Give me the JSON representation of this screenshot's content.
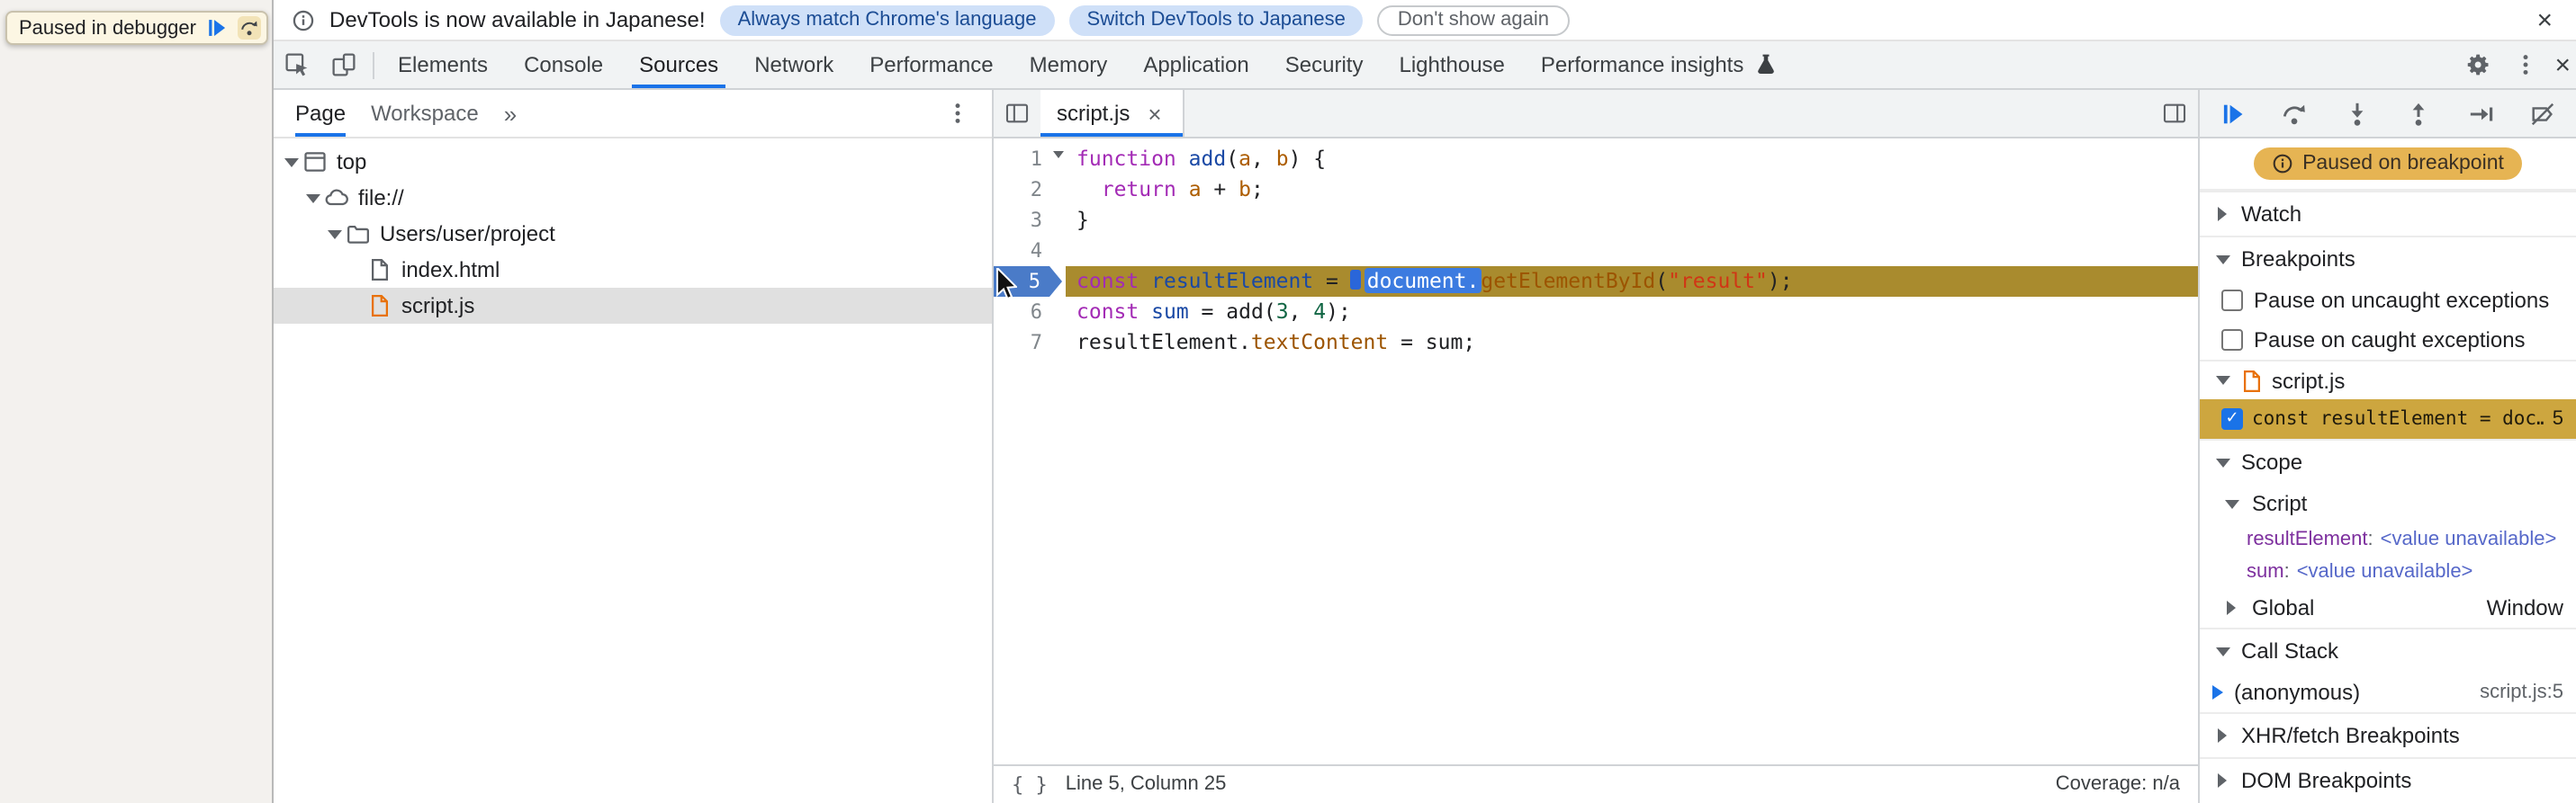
{
  "page_overlay": {
    "paused_label": "Paused in debugger"
  },
  "infobar": {
    "message": "DevTools is now available in Japanese!",
    "action_primary": "Always match Chrome's language",
    "action_secondary": "Switch DevTools to Japanese",
    "action_dismiss": "Don't show again",
    "close_glyph": "×"
  },
  "toolbar": {
    "tabs": [
      {
        "label": "Elements"
      },
      {
        "label": "Console"
      },
      {
        "label": "Sources"
      },
      {
        "label": "Network"
      },
      {
        "label": "Performance"
      },
      {
        "label": "Memory"
      },
      {
        "label": "Application"
      },
      {
        "label": "Security"
      },
      {
        "label": "Lighthouse"
      },
      {
        "label": "Performance insights",
        "icon": "flask-icon"
      }
    ],
    "active_tab": "Sources",
    "close_glyph": "×"
  },
  "navigator": {
    "tabs": [
      "Page",
      "Workspace"
    ],
    "active_tab": "Page",
    "overflow_glyph": "»",
    "tree": [
      {
        "depth": 0,
        "icon": "frame-icon",
        "label": "top",
        "expanded": true
      },
      {
        "depth": 1,
        "icon": "cloud-icon",
        "label": "file://",
        "expanded": true
      },
      {
        "depth": 2,
        "icon": "folder-icon",
        "label": "Users/user/project",
        "expanded": true
      },
      {
        "depth": 3,
        "icon": "file-icon",
        "label": "index.html"
      },
      {
        "depth": 3,
        "icon": "file-js-icon",
        "label": "script.js",
        "selected": true
      }
    ]
  },
  "editor": {
    "tab": {
      "label": "script.js",
      "close_glyph": "×"
    },
    "lines": [
      {
        "num": "1",
        "fold": true,
        "tokens": [
          [
            "k",
            "function"
          ],
          [
            "t",
            " "
          ],
          [
            "d",
            "add"
          ],
          [
            "t",
            "("
          ],
          [
            "p",
            "a"
          ],
          [
            "t",
            ", "
          ],
          [
            "p",
            "b"
          ],
          [
            "t",
            ") {"
          ]
        ]
      },
      {
        "num": "2",
        "tokens": [
          [
            "t",
            "  "
          ],
          [
            "k",
            "return"
          ],
          [
            "t",
            " "
          ],
          [
            "p",
            "a"
          ],
          [
            "t",
            " + "
          ],
          [
            "p",
            "b"
          ],
          [
            "t",
            ";"
          ]
        ]
      },
      {
        "num": "3",
        "tokens": [
          [
            "t",
            "}"
          ]
        ]
      },
      {
        "num": "4",
        "tokens": []
      },
      {
        "num": "5",
        "exec": true,
        "tokens": [
          [
            "k",
            "const"
          ],
          [
            "t",
            " "
          ],
          [
            "d",
            "resultElement"
          ],
          [
            "t",
            " = "
          ],
          [
            "m",
            ""
          ],
          [
            "doc",
            "document."
          ],
          [
            "pr",
            "getElementById"
          ],
          [
            "t",
            "("
          ],
          [
            "s",
            "\"result\""
          ],
          [
            "t",
            ");"
          ]
        ]
      },
      {
        "num": "6",
        "tokens": [
          [
            "k",
            "const"
          ],
          [
            "t",
            " "
          ],
          [
            "d",
            "sum"
          ],
          [
            "t",
            " = "
          ],
          [
            "t",
            "add"
          ],
          [
            "t",
            "("
          ],
          [
            "n",
            "3"
          ],
          [
            "t",
            ", "
          ],
          [
            "n",
            "4"
          ],
          [
            "t",
            ");"
          ]
        ]
      },
      {
        "num": "7",
        "tokens": [
          [
            "t",
            "resultElement."
          ],
          [
            "pr",
            "textContent"
          ],
          [
            "t",
            " = "
          ],
          [
            "t",
            "sum"
          ],
          [
            "t",
            ";"
          ]
        ]
      }
    ],
    "status": {
      "pretty_print": "{ }",
      "location": "Line 5, Column 25",
      "coverage": "Coverage: n/a"
    }
  },
  "debugger": {
    "toolbar_icons": [
      "resume-icon",
      "step-over-icon",
      "step-into-icon",
      "step-out-icon",
      "step-icon",
      "deactivate-breakpoints-icon"
    ],
    "paused_badge": "Paused on breakpoint",
    "watch": {
      "label": "Watch",
      "collapsed": true
    },
    "breakpoints": {
      "label": "Breakpoints",
      "checkboxes": [
        {
          "label": "Pause on uncaught exceptions",
          "checked": false
        },
        {
          "label": "Pause on caught exceptions",
          "checked": false
        }
      ],
      "file_group": {
        "label": "script.js"
      },
      "entries": [
        {
          "label": "const resultElement = doc…",
          "line": "5",
          "checked": true
        }
      ]
    },
    "scope": {
      "label": "Scope",
      "sections": [
        {
          "label": "Script",
          "expanded": true,
          "vars": [
            {
              "name": "resultElement",
              "value": "<value unavailable>"
            },
            {
              "name": "sum",
              "value": "<value unavailable>"
            }
          ]
        },
        {
          "label": "Global",
          "expanded": false,
          "value": "Window"
        }
      ]
    },
    "call_stack": {
      "label": "Call Stack",
      "frames": [
        {
          "name": "(anonymous)",
          "location": "script.js:5",
          "active": true
        }
      ]
    },
    "xhr": {
      "label": "XHR/fetch Breakpoints",
      "collapsed": true
    },
    "dom": {
      "label": "DOM Breakpoints",
      "collapsed": true
    }
  },
  "colors": {
    "accent": "#1a73e8",
    "paused_badge_bg": "#e6b453",
    "execution_line_bg": "#a98b2e",
    "breakpoint_entry_bg": "#cda63f",
    "breakpoint_tag_bg": "#4a7bc8"
  }
}
